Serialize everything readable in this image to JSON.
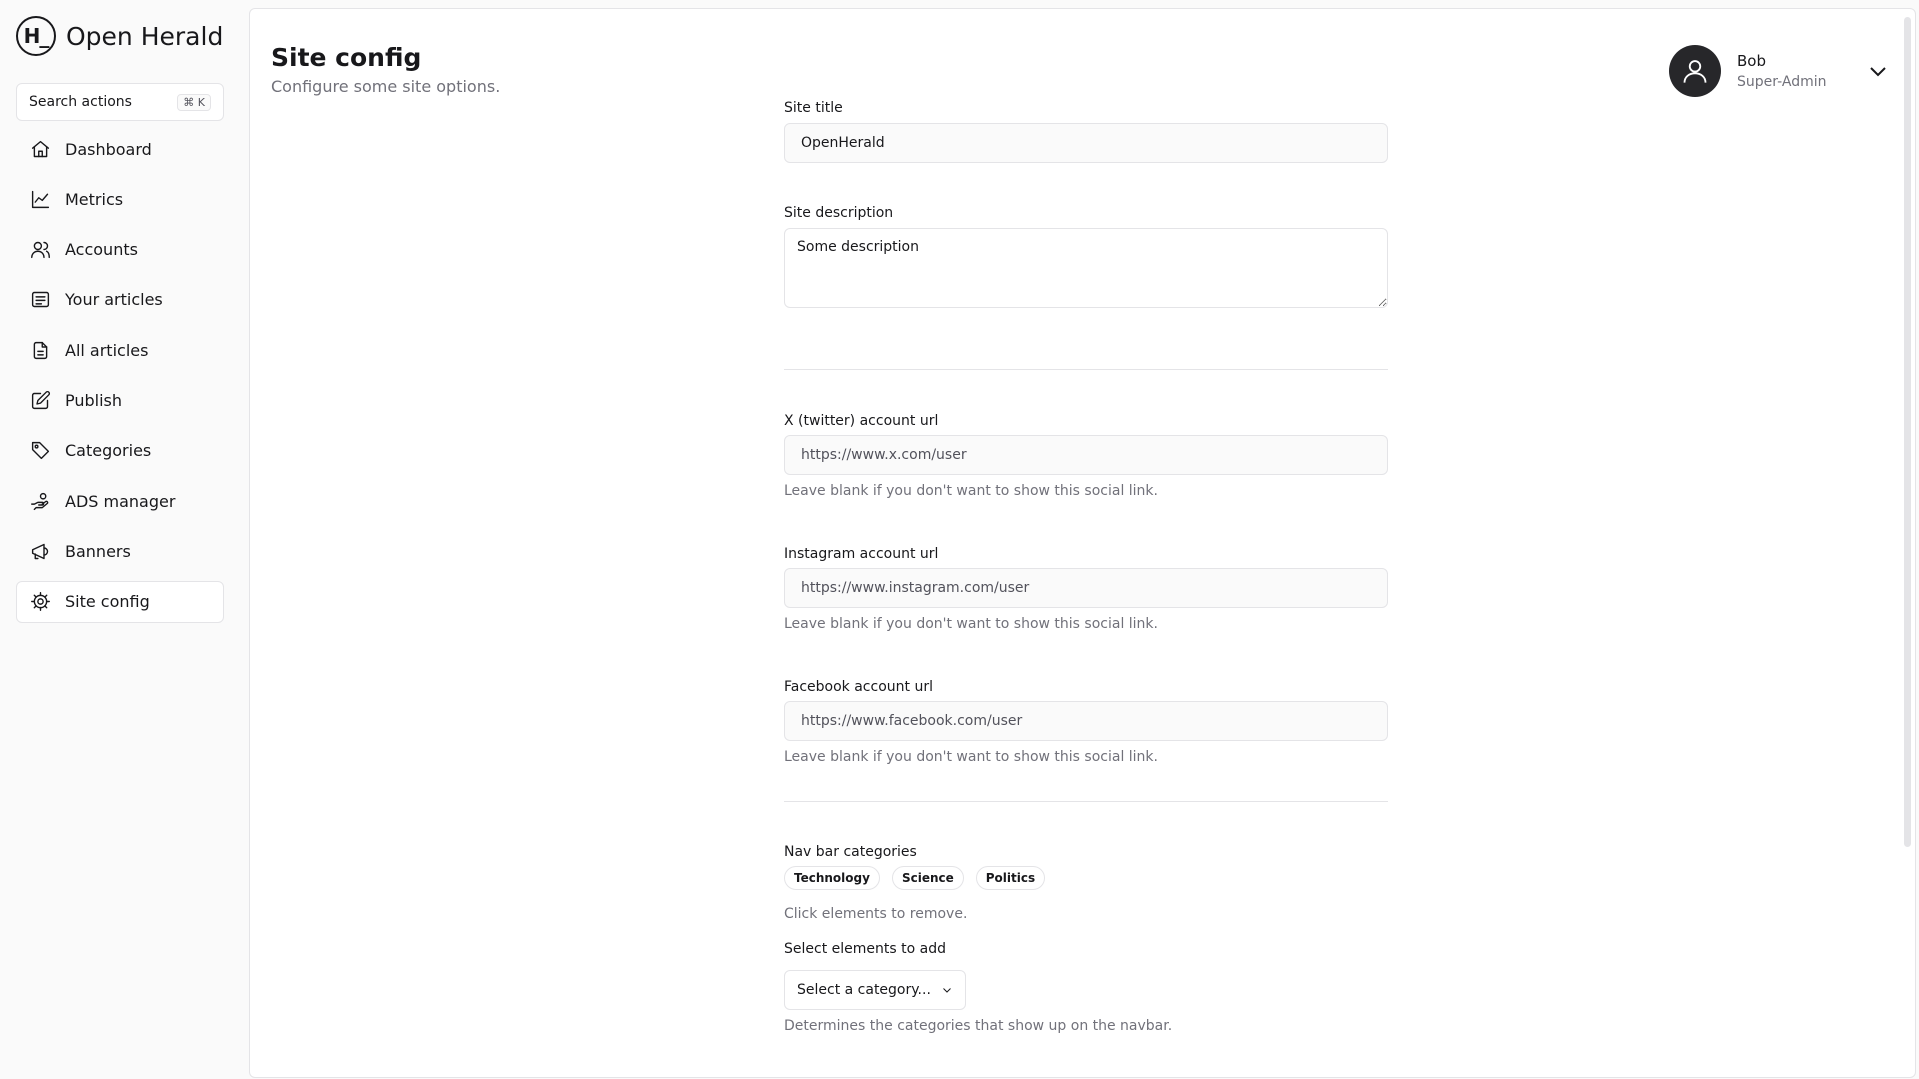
{
  "brand": {
    "logo_mark": "H_",
    "name": "Open Herald"
  },
  "search": {
    "label": "Search actions",
    "shortcut": "⌘ K"
  },
  "sidebar": {
    "items": [
      {
        "label": "Dashboard",
        "icon": "home-icon"
      },
      {
        "label": "Metrics",
        "icon": "line-chart-icon"
      },
      {
        "label": "Accounts",
        "icon": "users-icon"
      },
      {
        "label": "Your articles",
        "icon": "list-icon"
      },
      {
        "label": "All articles",
        "icon": "files-icon"
      },
      {
        "label": "Publish",
        "icon": "edit-icon"
      },
      {
        "label": "Categories",
        "icon": "tag-icon"
      },
      {
        "label": "ADS manager",
        "icon": "hand-coins-icon"
      },
      {
        "label": "Banners",
        "icon": "megaphone-icon"
      },
      {
        "label": "Site config",
        "icon": "gear-icon",
        "active": true
      }
    ]
  },
  "header": {
    "title": "Site config",
    "subtitle": "Configure some site options."
  },
  "user": {
    "name": "Bob",
    "role": "Super-Admin"
  },
  "form": {
    "site_title": {
      "label": "Site title",
      "value": "OpenHerald"
    },
    "site_description": {
      "label": "Site description",
      "value": "Some description"
    },
    "twitter": {
      "label": "X (twitter) account url",
      "placeholder": "https://www.x.com/user",
      "help": "Leave blank if you don't want to show this social link."
    },
    "instagram": {
      "label": "Instagram account url",
      "placeholder": "https://www.instagram.com/user",
      "help": "Leave blank if you don't want to show this social link."
    },
    "facebook": {
      "label": "Facebook account url",
      "placeholder": "https://www.facebook.com/user",
      "help": "Leave blank if you don't want to show this social link."
    },
    "nav_categories": {
      "label": "Nav bar categories",
      "chips": [
        "Technology",
        "Science",
        "Politics"
      ],
      "chips_help": "Click elements to remove.",
      "add_label": "Select elements to add",
      "select_placeholder": "Select a category...",
      "help": "Determines the categories that show up on the navbar."
    }
  },
  "colors": {
    "background": "#fafafa",
    "panel": "#ffffff",
    "border": "#e4e4e7",
    "text": "#18181b",
    "muted": "#71717a",
    "avatar": "#27272a"
  }
}
